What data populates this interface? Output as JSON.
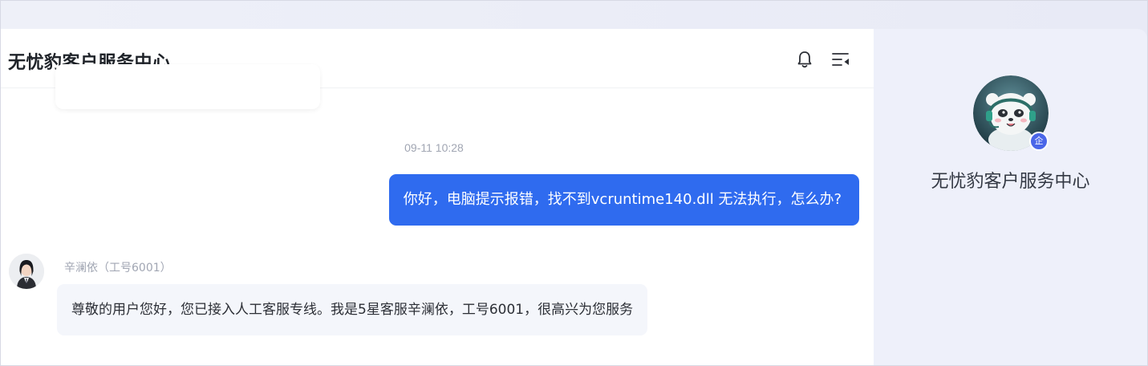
{
  "header": {
    "title": "无忧豹客户服务中心",
    "icons": [
      "bell-icon",
      "chat-list-icon"
    ]
  },
  "messages": {
    "timestamp": "09-11 10:28",
    "user_message": "你好，电脑提示报错，找不到vcruntime140.dll 无法执行，怎么办?",
    "agent_name": "辛澜依（工号6001）",
    "agent_message": "尊敬的用户您好，您已接入人工客服专线。我是5星客服辛澜依，工号6001，很高兴为您服务"
  },
  "sidebar": {
    "name": "无忧豹客户服务中心",
    "badge": "企"
  },
  "colors": {
    "accent": "#2f6bef",
    "incoming_bubble": "#f4f6fb",
    "sidebar_bg": "#eef0fa"
  }
}
